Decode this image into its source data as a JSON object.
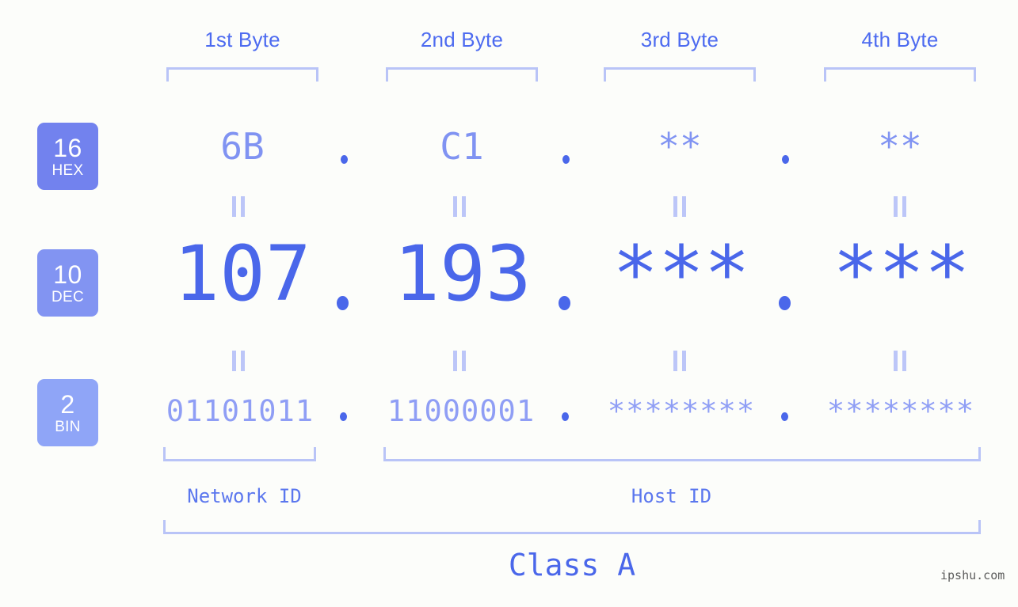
{
  "colors": {
    "background": "#fcfdfa",
    "accent_strong": "#4a67ea",
    "accent_mid": "#5b77ee",
    "accent_light": "#8093f2",
    "accent_lighter": "#8f9ef5",
    "bracket": "#b9c4f7",
    "badge_hex": "#7282ee",
    "badge_dec": "#8294f2",
    "badge_bin": "#8fa5f7"
  },
  "byte_headers": [
    {
      "label": "1st Byte"
    },
    {
      "label": "2nd Byte"
    },
    {
      "label": "3rd Byte"
    },
    {
      "label": "4th Byte"
    }
  ],
  "rows": [
    {
      "base_number": "16",
      "base_abbr": "HEX",
      "values": [
        "6B",
        "C1",
        "**",
        "**"
      ],
      "separator": "."
    },
    {
      "base_number": "10",
      "base_abbr": "DEC",
      "values": [
        "107",
        "193",
        "***",
        "***"
      ],
      "separator": "."
    },
    {
      "base_number": "2",
      "base_abbr": "BIN",
      "values": [
        "01101011",
        "11000001",
        "********",
        "********"
      ],
      "separator": "."
    }
  ],
  "id_sections": [
    {
      "label": "Network ID"
    },
    {
      "label": "Host ID"
    }
  ],
  "class_label": "Class A",
  "watermark": "ipshu.com"
}
